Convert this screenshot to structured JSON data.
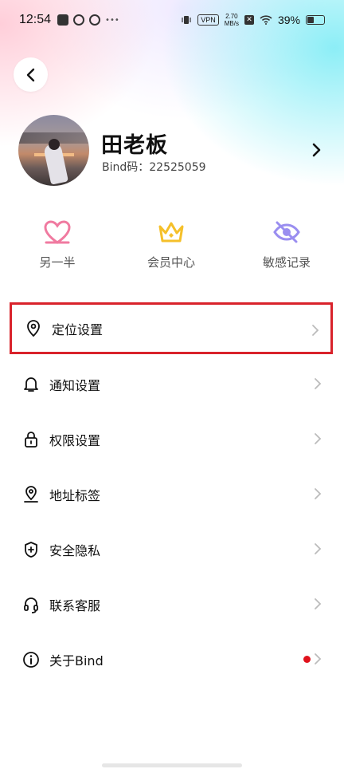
{
  "status_bar": {
    "time": "12:54",
    "vpn": "VPN",
    "speed_value": "2.70",
    "speed_unit": "MB/s",
    "battery": "39%"
  },
  "profile": {
    "name": "田老板",
    "bind_id": "Bind码：22525059"
  },
  "quick_actions": [
    {
      "label": "另一半",
      "icon": "heart-icon",
      "color": "#f07aa0"
    },
    {
      "label": "会员中心",
      "icon": "crown-icon",
      "color": "#f5c02a"
    },
    {
      "label": "敏感记录",
      "icon": "eye-off-icon",
      "color": "#9a8ef0"
    }
  ],
  "menu": [
    {
      "label": "定位设置",
      "icon": "location-pin-icon"
    },
    {
      "label": "通知设置",
      "icon": "bell-icon"
    },
    {
      "label": "权限设置",
      "icon": "lock-icon"
    },
    {
      "label": "地址标签",
      "icon": "map-pin-icon"
    },
    {
      "label": "安全隐私",
      "icon": "shield-plus-icon"
    },
    {
      "label": "联系客服",
      "icon": "headset-icon"
    },
    {
      "label": "关于Bind",
      "icon": "info-icon",
      "has_badge": true
    }
  ],
  "colors": {
    "highlight_border": "#d9222b",
    "badge": "#e0121c"
  }
}
